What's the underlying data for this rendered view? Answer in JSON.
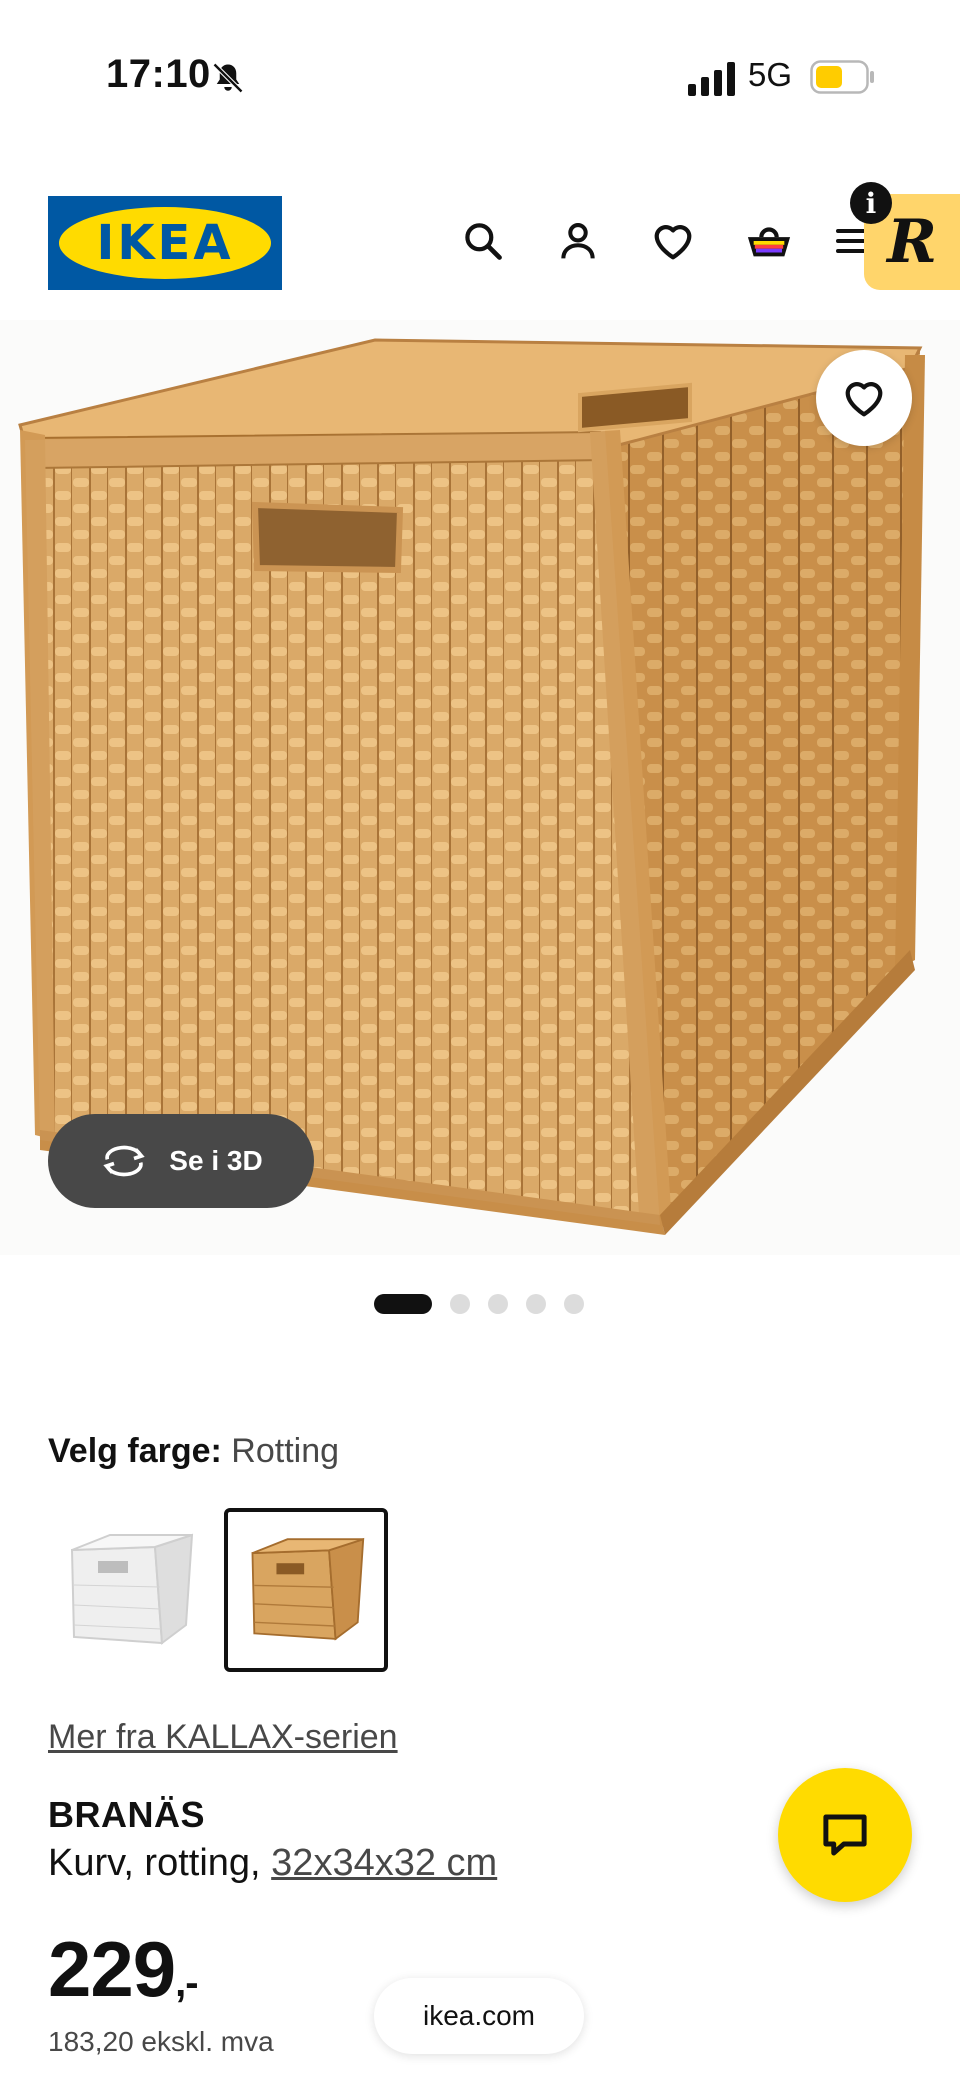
{
  "status_bar": {
    "time": "17:10",
    "network": "5G",
    "battery_color": "#ffcc00"
  },
  "header": {
    "logo_text": "IKEA",
    "badge_letter": "R",
    "info_letter": "i",
    "icons": [
      "search-icon",
      "account-icon",
      "heart-icon",
      "basket-icon",
      "menu-icon"
    ]
  },
  "gallery": {
    "view_3d_label": "Se i 3D",
    "image_count": 5,
    "active_index": 0
  },
  "color_picker": {
    "label": "Velg farge:",
    "value": "Rotting",
    "options": [
      "white",
      "rattan"
    ],
    "selected_index": 1
  },
  "product": {
    "series_link": "Mer fra KALLAX-serien",
    "name": "BRANÄS",
    "desc_prefix": "Kurv, rotting, ",
    "desc_size": "32x34x32 cm",
    "price_main": "229",
    "price_suffix": ",-",
    "price_ex_vat": "183,20 ekskl. mva"
  },
  "browser": {
    "url": "ikea.com"
  },
  "colors": {
    "ikea_blue": "#0058a3",
    "ikea_yellow": "#ffdb00"
  }
}
